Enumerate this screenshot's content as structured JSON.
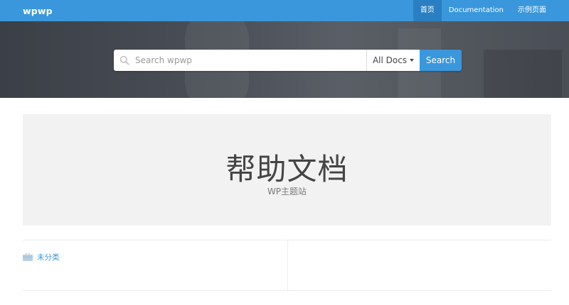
{
  "navbar": {
    "brand": "wpwp",
    "items": [
      {
        "label": "首页",
        "active": true
      },
      {
        "label": "Documentation",
        "active": false
      },
      {
        "label": "示例页面",
        "active": false
      }
    ]
  },
  "search": {
    "placeholder": "Search wpwp",
    "scope_label": "All Docs",
    "button_label": "Search"
  },
  "hero": {
    "title": "帮助文档",
    "subtitle": "WP主题站"
  },
  "categories": [
    {
      "label": "未分类",
      "icon": "folder-icon"
    }
  ],
  "colors": {
    "accent": "#3a97dc",
    "accent_dark": "#2a7fc2",
    "banner": "#4b5058",
    "panel": "#f2f2f2"
  }
}
